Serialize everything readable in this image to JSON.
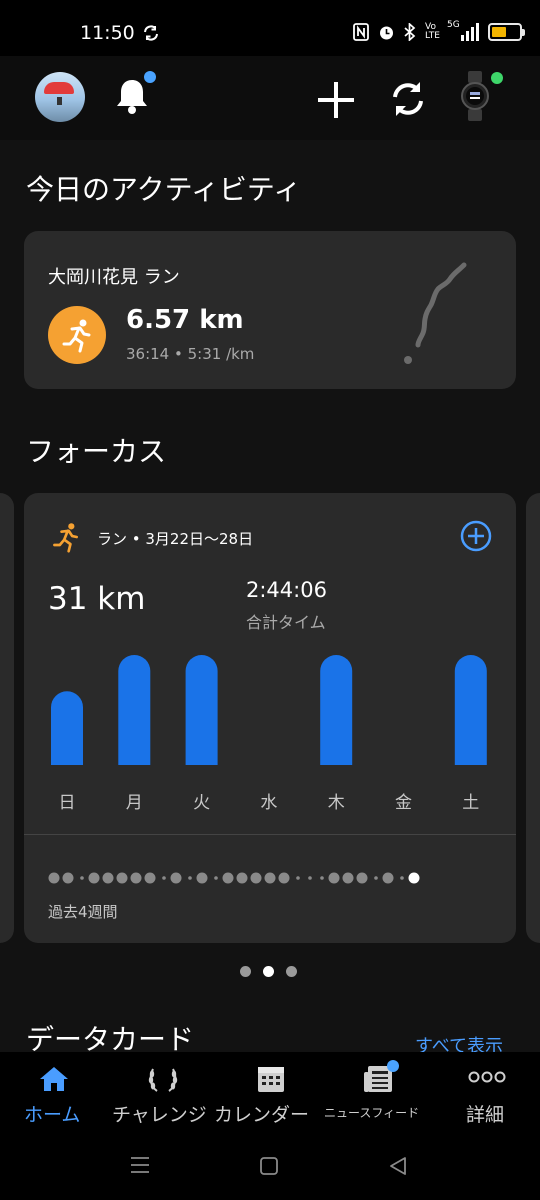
{
  "status_bar": {
    "time": "11:50",
    "network": "5G",
    "volte": "VoLTE"
  },
  "app_bar": {
    "avatar": "profile-avatar",
    "notification_badge": true,
    "device_connected": true
  },
  "today": {
    "section_title": "今日のアクティビティ",
    "activity": {
      "name": "大岡川花見 ラン",
      "distance": "6.57 km",
      "stats": "36:14 • 5:31 /km",
      "icon": "running-icon",
      "icon_color": "#f5a132"
    }
  },
  "focus": {
    "section_title": "フォーカス",
    "card": {
      "header": "ラン • 3月22日〜28日",
      "total_distance": "31 km",
      "total_time": "2:44:06",
      "total_time_label": "合計タイム",
      "past_label": "過去4週間",
      "bar_color": "#1a73e8"
    },
    "pager_active_index": 1,
    "pager_count": 3
  },
  "chart_data": {
    "type": "bar",
    "categories": [
      "日",
      "月",
      "火",
      "水",
      "木",
      "金",
      "土"
    ],
    "values": [
      0.67,
      1.0,
      1.0,
      0,
      1.0,
      0,
      1.0
    ],
    "title": "",
    "xlabel": "",
    "ylabel": ""
  },
  "history_dots": [
    2,
    2,
    1,
    2,
    2,
    2,
    2,
    2,
    1,
    2,
    1,
    2,
    1,
    2,
    2,
    2,
    2,
    2,
    1,
    1,
    1,
    2,
    2,
    2,
    1,
    2,
    1,
    3
  ],
  "data_cards": {
    "section_title": "データカード",
    "show_all": "すべて表示"
  },
  "bottom_nav": {
    "items": [
      {
        "label": "ホーム",
        "icon": "home-icon",
        "active": true
      },
      {
        "label": "チャレンジ",
        "icon": "laurel-icon",
        "active": false
      },
      {
        "label": "カレンダー",
        "icon": "calendar-icon",
        "active": false
      },
      {
        "label": "ニュースフィード",
        "icon": "newsfeed-icon",
        "active": false,
        "badge": true
      },
      {
        "label": "詳細",
        "icon": "more-icon",
        "active": false
      }
    ],
    "active_color": "#4a9dff"
  }
}
